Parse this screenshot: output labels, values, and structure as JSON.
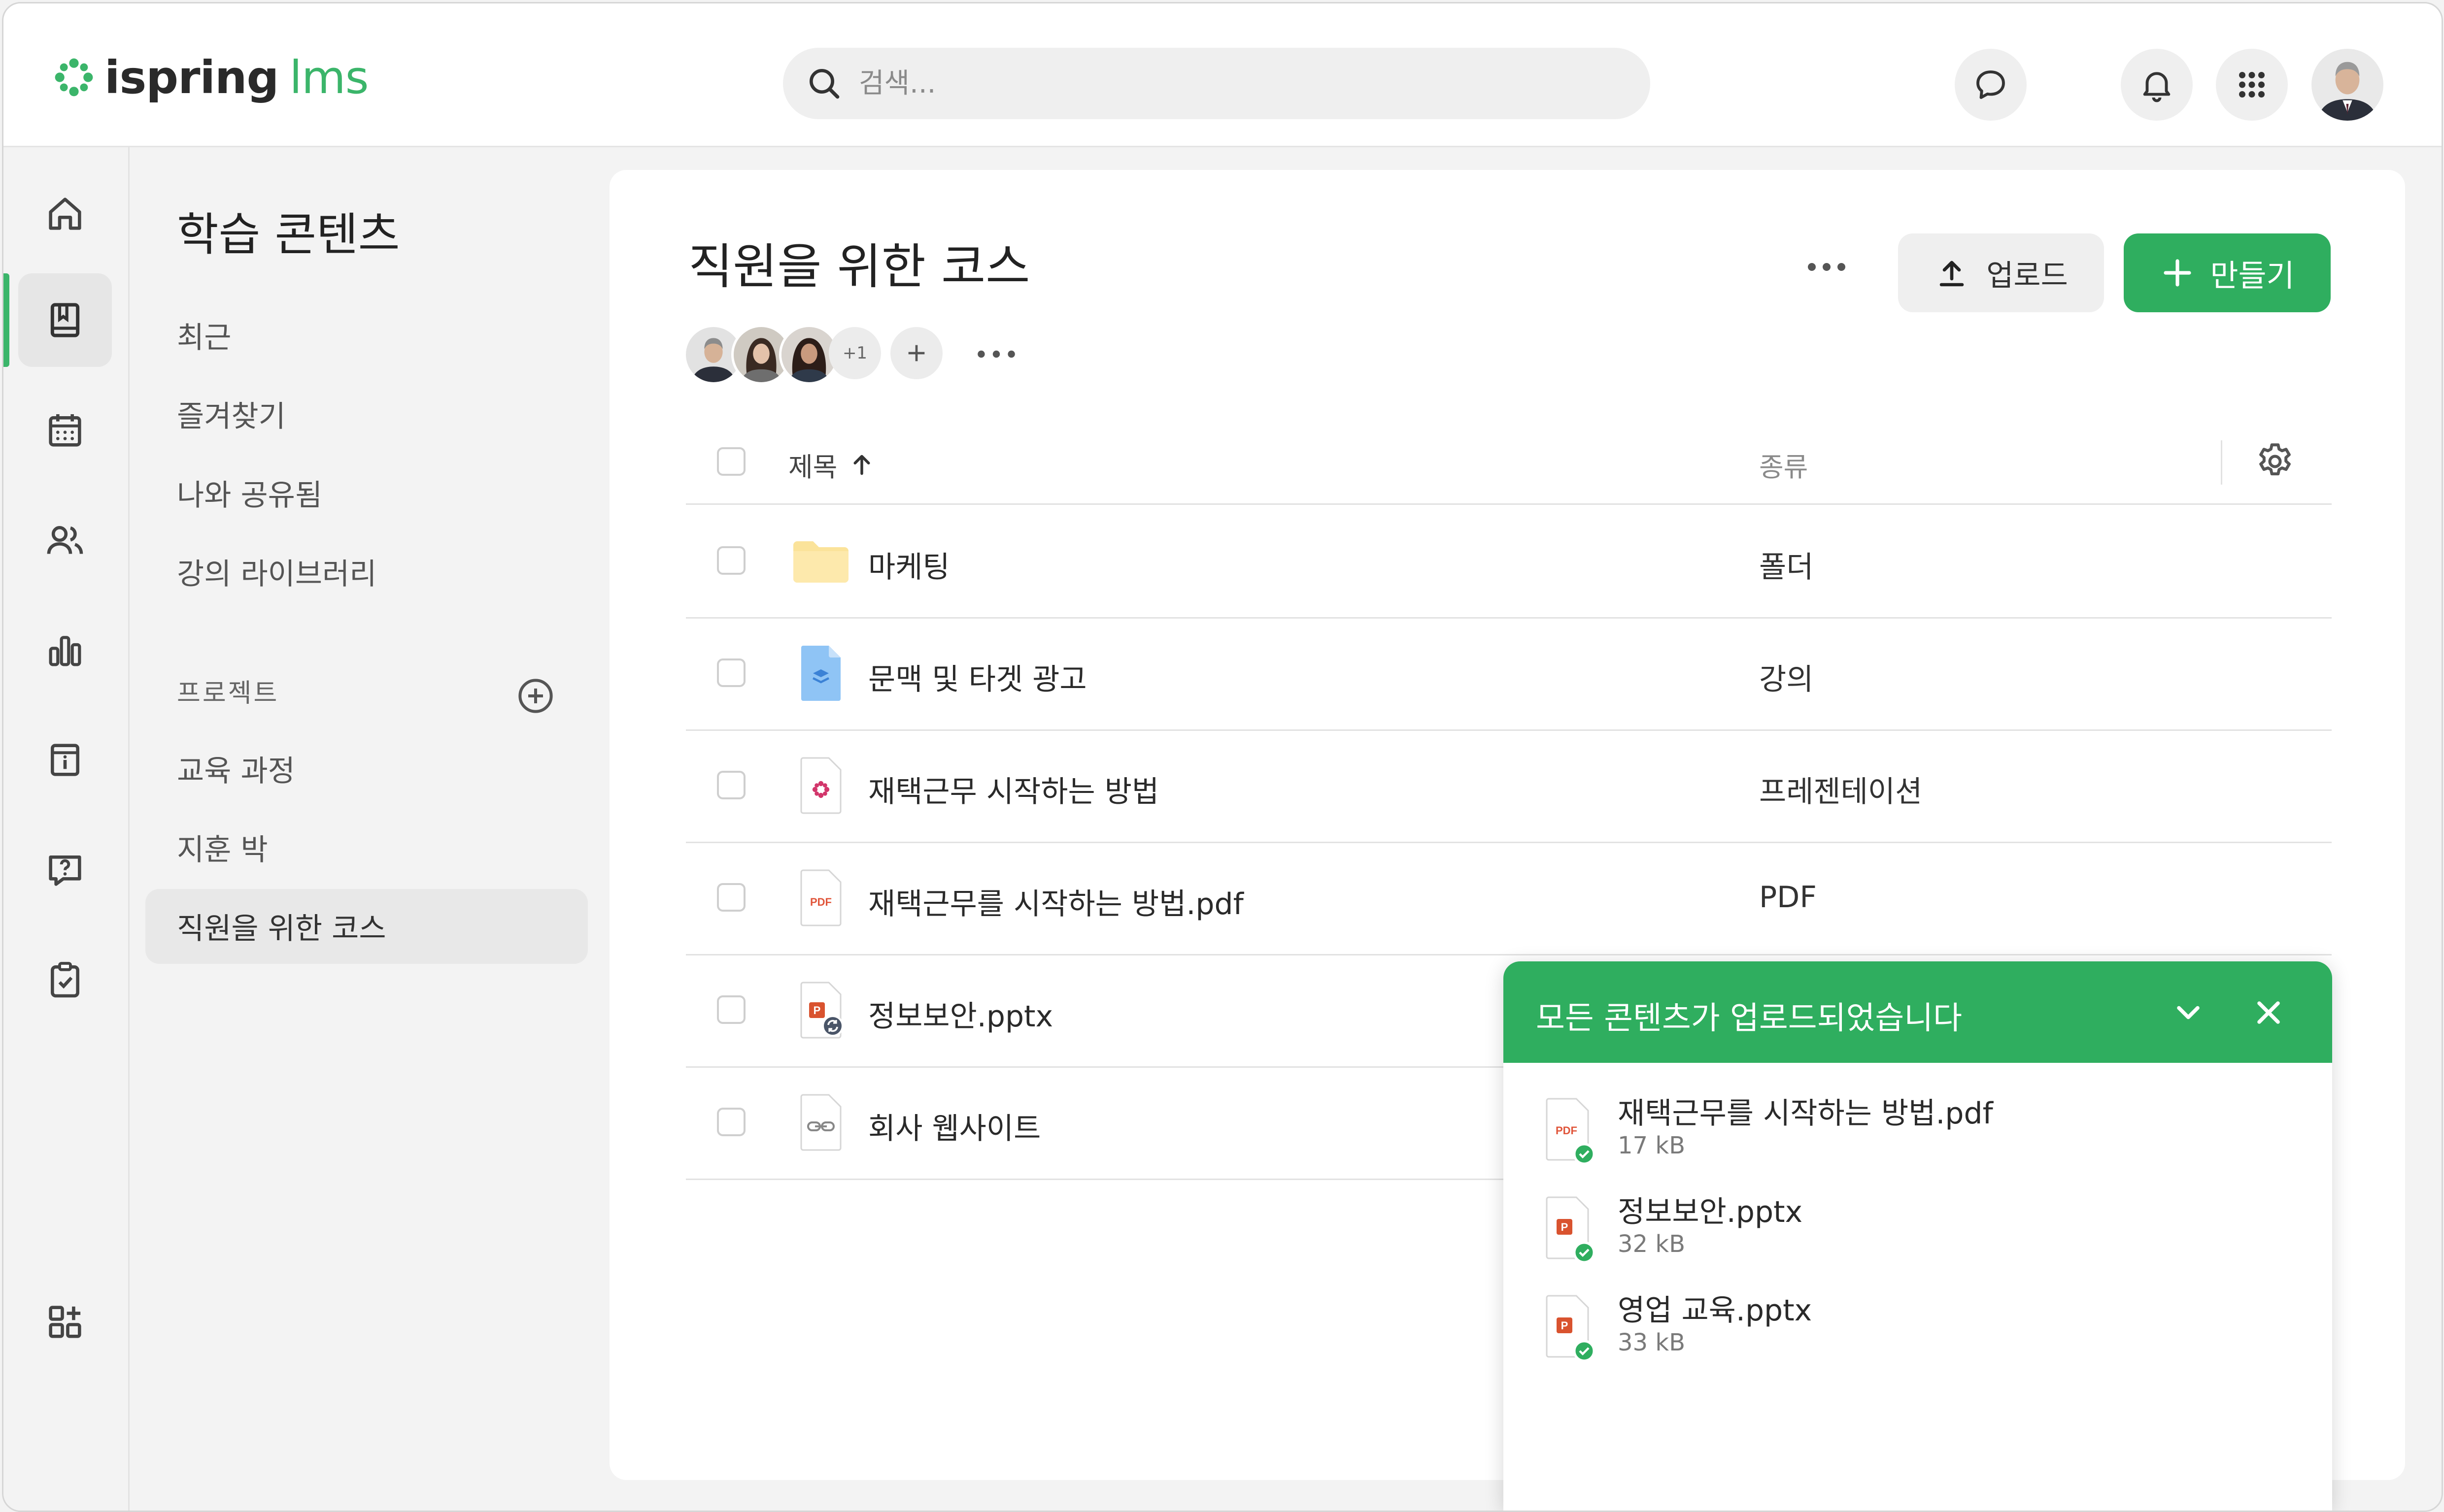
{
  "app": {
    "logo_word": "ispring",
    "logo_lms": "lms",
    "brand_color": "#3bb56a",
    "accent_color": "#2fae5f"
  },
  "header": {
    "search": {
      "placeholder": "검색...",
      "value": ""
    },
    "buttons": [
      "chat-icon",
      "bell-icon",
      "apps-grid-icon",
      "user-avatar"
    ]
  },
  "rail": {
    "items": [
      "home-icon",
      "courses-book-icon",
      "calendar-icon",
      "users-icon",
      "reports-chart-icon",
      "info-board-icon",
      "help-question-icon",
      "tasks-clipboard-icon"
    ],
    "active_index": 1,
    "bottom_item": "add-widget-icon"
  },
  "nav": {
    "title": "학습 콘텐츠",
    "items": [
      "최근",
      "즐겨찾기",
      "나와 공유됨",
      "강의 라이브러리"
    ],
    "section_label": "프로젝트",
    "projects": [
      "교육 과정",
      "지훈 박",
      "직원을 위한 코스"
    ],
    "selected_project_index": 2
  },
  "main": {
    "title": "직원을 위한 코스",
    "upload_label": "업로드",
    "create_label": "만들기",
    "members_extra": "+1",
    "table": {
      "col_title": "제목",
      "col_type": "종류",
      "sort": "ascending",
      "rows": [
        {
          "name": "마케팅",
          "type": "폴더",
          "icon": "folder-icon"
        },
        {
          "name": "문맥 및 타겟 광고",
          "type": "강의",
          "icon": "course-icon"
        },
        {
          "name": "재택근무 시작하는 방법",
          "type": "프레젠테이션",
          "icon": "presentation-icon"
        },
        {
          "name": "재택근무를 시작하는 방법.pdf",
          "type": "PDF",
          "icon": "pdf-file-icon"
        },
        {
          "name": "정보보안.pptx",
          "type": "",
          "icon": "pptx-file-icon"
        },
        {
          "name": "회사 웹사이트",
          "type": "",
          "icon": "link-file-icon"
        }
      ]
    }
  },
  "toast": {
    "title": "모든 콘텐츠가 업로드되었습니다",
    "items": [
      {
        "name": "재택근무를 시작하는 방법.pdf",
        "size": "17 kB",
        "icon": "pdf-file-icon"
      },
      {
        "name": "정보보안.pptx",
        "size": "32 kB",
        "icon": "pptx-file-icon"
      },
      {
        "name": "영업 교육.pptx",
        "size": "33 kB",
        "icon": "pptx-file-icon"
      }
    ]
  }
}
